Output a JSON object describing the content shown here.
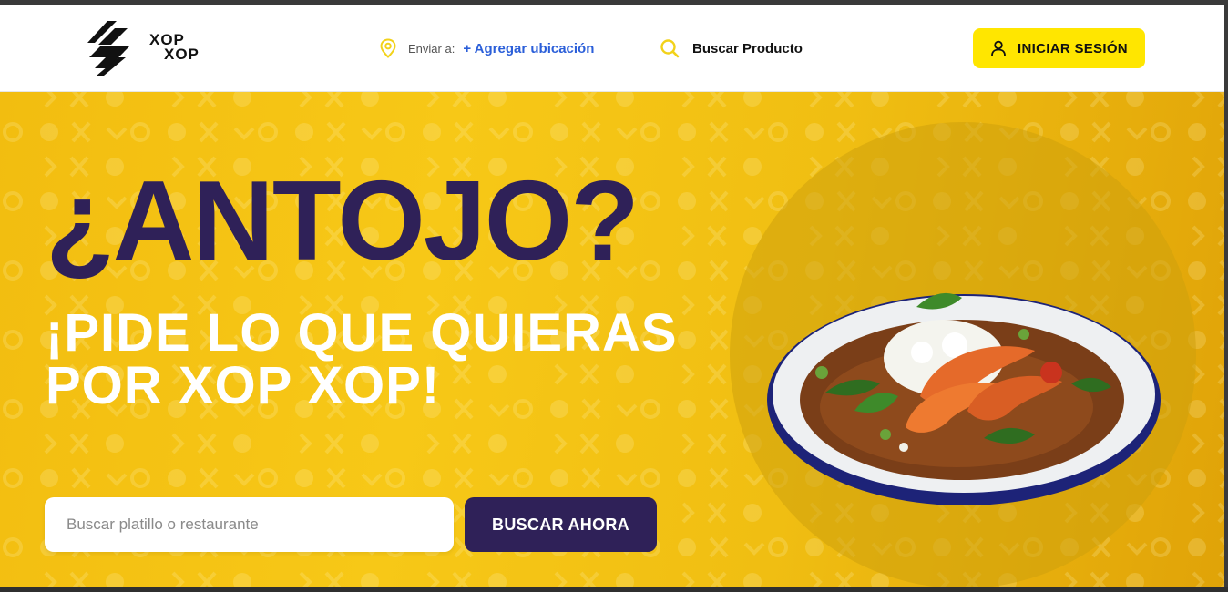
{
  "header": {
    "logo": {
      "text_line1": "XOP",
      "text_line2": "XOP",
      "icon": "xopxop-logo-mark"
    },
    "location": {
      "icon": "map-pin-icon",
      "label": "Enviar a:",
      "action": "+ Agregar ubicación"
    },
    "search": {
      "icon": "search-icon",
      "label": "Buscar Producto"
    },
    "login": {
      "icon": "user-icon",
      "label": "INICIAR SESIÓN"
    }
  },
  "hero": {
    "headline": "¿ANTOJO?",
    "subline": "¡PIDE LO QUE QUIERAS POR XOP XOP!",
    "search_placeholder": "Buscar platillo o restaurante",
    "search_value": "",
    "search_button": "BUSCAR AHORA",
    "image": "shrimp-curry-dish"
  },
  "colors": {
    "accent_yellow": "#ffe600",
    "hero_yellow": "#f7c817",
    "deep_purple": "#2f2158",
    "link_blue": "#2b5fd9",
    "white": "#ffffff"
  }
}
